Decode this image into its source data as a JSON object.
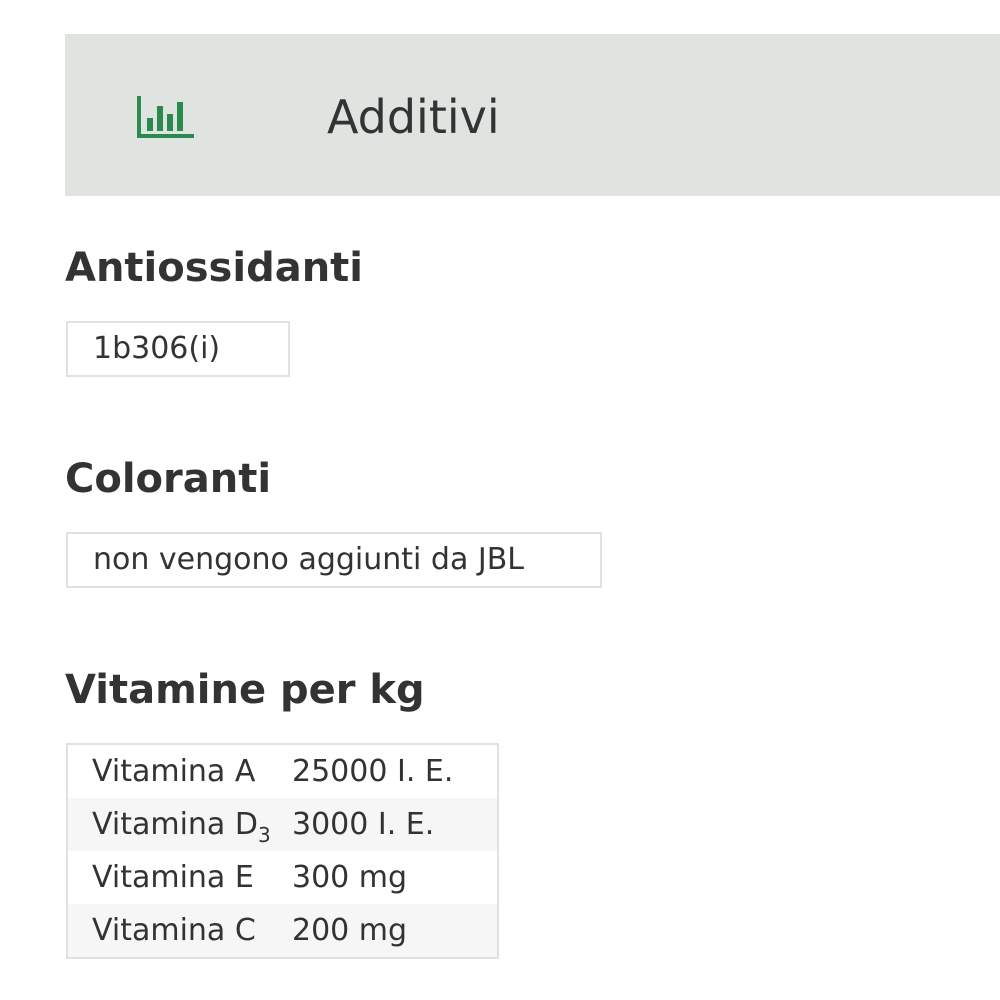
{
  "header": {
    "icon": "bar-chart-icon",
    "icon_color": "#2b8a4f",
    "background": "#dfe4e1",
    "title": "Additivi"
  },
  "sections": {
    "antioxidants": {
      "heading": "Antiossidanti",
      "value": "1b306(i)"
    },
    "colorants": {
      "heading": "Coloranti",
      "value": "non vengono aggiunti da JBL"
    },
    "vitamins": {
      "heading": "Vitamine per kg",
      "rows": [
        {
          "name": "Vitamina A",
          "amount": "25000 I. E."
        },
        {
          "name": "Vitamina D",
          "name_subscript": "3",
          "amount": "3000 I. E."
        },
        {
          "name": "Vitamina E",
          "amount": "300 mg"
        },
        {
          "name": "Vitamina C",
          "amount": "200 mg"
        }
      ]
    }
  }
}
